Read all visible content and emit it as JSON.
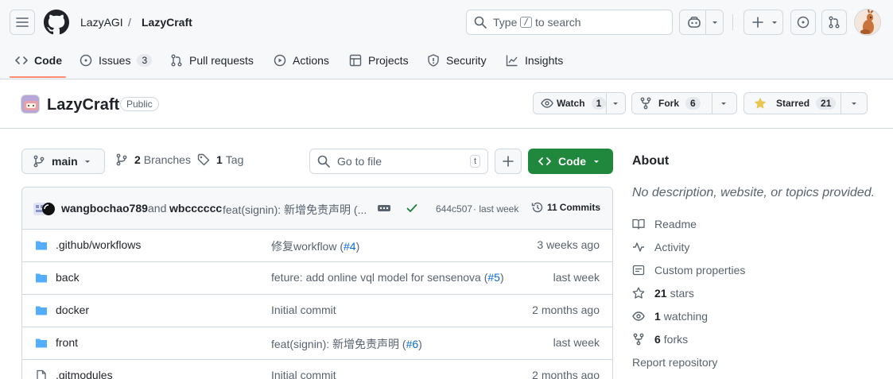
{
  "header": {
    "owner": "LazyAGI",
    "separator": "/",
    "repo": "LazyCraft",
    "search": {
      "prefix": "Type",
      "key": "/",
      "suffix": "to search"
    }
  },
  "tabs": [
    {
      "label": "Code",
      "icon": "code-icon"
    },
    {
      "label": "Issues",
      "icon": "issue-opened-icon",
      "count": "3"
    },
    {
      "label": "Pull requests",
      "icon": "git-pull-request-icon"
    },
    {
      "label": "Actions",
      "icon": "play-icon"
    },
    {
      "label": "Projects",
      "icon": "table-icon"
    },
    {
      "label": "Security",
      "icon": "shield-icon"
    },
    {
      "label": "Insights",
      "icon": "graph-icon"
    }
  ],
  "repo": {
    "name": "LazyCraft",
    "visibility": "Public",
    "watch": {
      "label": "Watch",
      "count": "1"
    },
    "fork": {
      "label": "Fork",
      "count": "6"
    },
    "star": {
      "label": "Starred",
      "count": "21"
    }
  },
  "toolbar": {
    "branch": "main",
    "branches_count": "2",
    "branches_label": "Branches",
    "tags_count": "1",
    "tags_label": "Tag",
    "goto_placeholder": "Go to file",
    "goto_key": "t",
    "code_label": "Code"
  },
  "commit": {
    "author1": "wangbochao789",
    "and": "and",
    "author2": "wbcccccc",
    "message": "feat(signin): 新增免责声明 (...",
    "hash": "644c507",
    "time": "· last week",
    "commits_count": "11",
    "commits_label": "Commits"
  },
  "files": [
    {
      "name": ".github/workflows",
      "msg": "修复workflow (",
      "ref": "#4",
      "msg_end": ")",
      "date": "3 weeks ago",
      "type": "folder"
    },
    {
      "name": "back",
      "msg": "feture: add online vql model for sensenova (",
      "ref": "#5",
      "msg_end": ")",
      "date": "last week",
      "type": "folder"
    },
    {
      "name": "docker",
      "msg": "Initial commit",
      "ref": "",
      "msg_end": "",
      "date": "2 months ago",
      "type": "folder"
    },
    {
      "name": "front",
      "msg": "feat(signin): 新增免责声明 (",
      "ref": "#6",
      "msg_end": ")",
      "date": "last week",
      "type": "folder"
    },
    {
      "name": ".gitmodules",
      "msg": "Initial commit",
      "ref": "",
      "msg_end": "",
      "date": "2 months ago",
      "type": "file"
    }
  ],
  "about": {
    "title": "About",
    "description": "No description, website, or topics provided.",
    "readme": "Readme",
    "activity": "Activity",
    "custom": "Custom properties",
    "stars_count": "21",
    "stars_label": "stars",
    "watching_count": "1",
    "watching_label": "watching",
    "forks_count": "6",
    "forks_label": "forks",
    "report": "Report repository"
  },
  "colors": {
    "accent_green": "#1f883d",
    "link": "#0969da",
    "folder": "#54aeff",
    "tab_underline": "#fd8c73",
    "star": "#eac54f"
  }
}
